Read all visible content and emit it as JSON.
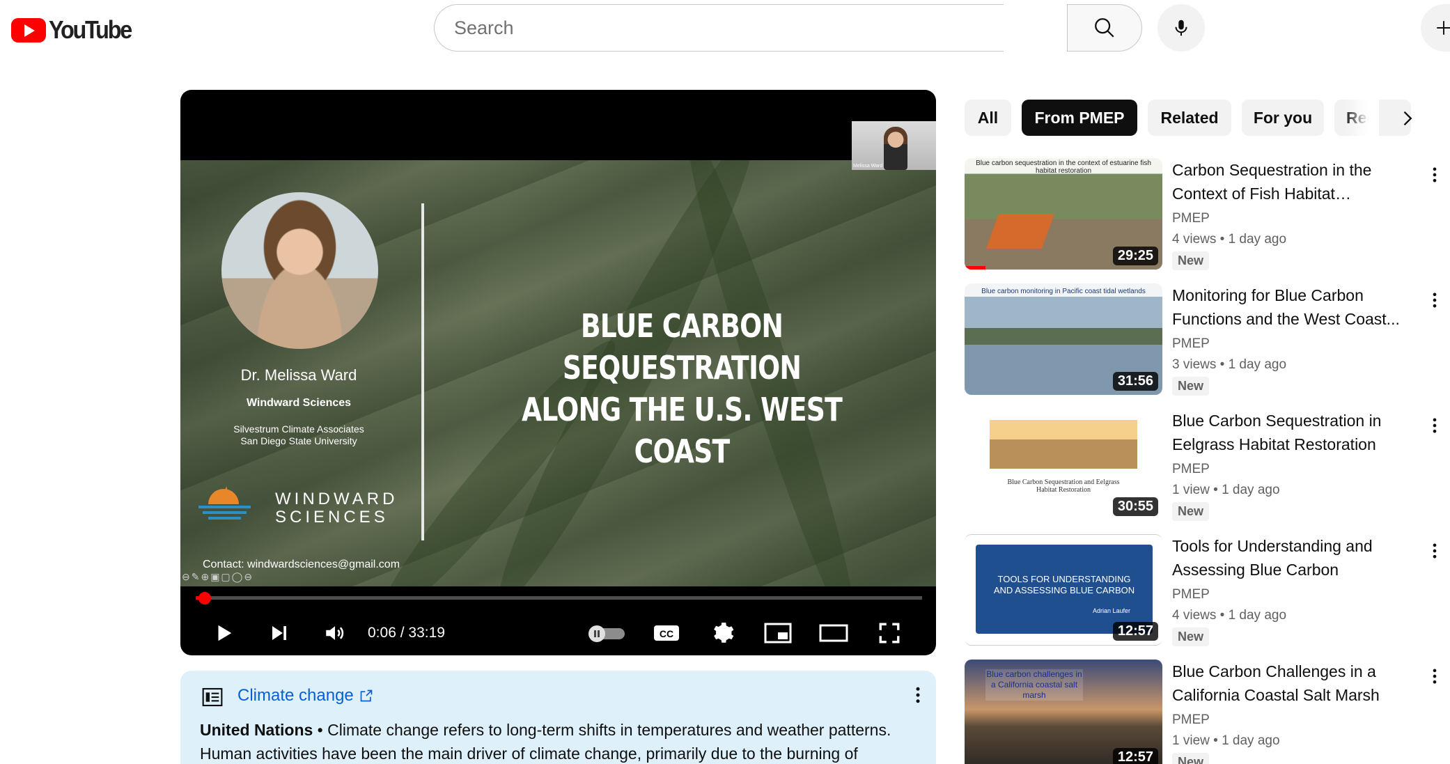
{
  "masthead": {
    "logo_text": "YouTube",
    "search_placeholder": "Search"
  },
  "player": {
    "slide": {
      "title_line1": "BLUE CARBON SEQUESTRATION",
      "title_line2": "ALONG THE U.S. WEST COAST",
      "speaker_name": "Dr. Melissa Ward",
      "speaker_org": "Windward Sciences",
      "affiliation_line1": "Silvestrum Climate Associates",
      "affiliation_line2": "San Diego State University",
      "logo_line1": "WINDWARD",
      "logo_line2": "SCIENCES",
      "contact": "Contact: windwardsciences@gmail.com",
      "pip_label": "Melissa Ward"
    },
    "progress_fraction": 0.003,
    "time_current": "0:06",
    "time_separator": " / ",
    "time_total": "33:19"
  },
  "info_card": {
    "link_text": "Climate change",
    "source": "United Nations",
    "bullet": " • ",
    "description": "Climate change refers to long-term shifts in temperatures and weather patterns. Human activities have been the main driver of climate change, primarily due to the burning of"
  },
  "chips": [
    {
      "label": "All",
      "active": false
    },
    {
      "label": "From PMEP",
      "active": true
    },
    {
      "label": "Related",
      "active": false
    },
    {
      "label": "For you",
      "active": false
    },
    {
      "label": "Rec",
      "active": false
    }
  ],
  "recommendations": [
    {
      "title": "Carbon Sequestration in the Context of Fish Habitat Restoration",
      "channel": "PMEP",
      "views": "4 views",
      "age": "1 day ago",
      "badge": "New",
      "duration": "29:25",
      "thumb_caption": "Blue carbon sequestration in the context of estuarine fish habitat restoration"
    },
    {
      "title": "Monitoring for Blue Carbon Functions and the West Coast...",
      "channel": "PMEP",
      "views": "3 views",
      "age": "1 day ago",
      "badge": "New",
      "duration": "31:56",
      "thumb_caption": "Blue carbon monitoring in Pacific coast tidal wetlands"
    },
    {
      "title": "Blue Carbon Sequestration in Eelgrass Habitat Restoration",
      "channel": "PMEP",
      "views": "1 view",
      "age": "1 day ago",
      "badge": "New",
      "duration": "30:55",
      "thumb_caption": "Blue Carbon Sequestration and Eelgrass Habitat Restoration"
    },
    {
      "title": "Tools for Understanding and Assessing Blue Carbon",
      "channel": "PMEP",
      "views": "4 views",
      "age": "1 day ago",
      "badge": "New",
      "duration": "12:57",
      "thumb_caption": "TOOLS FOR UNDERSTANDING AND ASSESSING BLUE CARBON",
      "thumb_author": "Adrian Laufer"
    },
    {
      "title": "Blue Carbon Challenges in a California Coastal Salt Marsh",
      "channel": "PMEP",
      "views": "1 view",
      "age": "1 day ago",
      "badge": "New",
      "duration": "12:57",
      "thumb_caption": "Blue carbon challenges in a California coastal salt marsh"
    }
  ],
  "colors": {
    "brand_red": "#ff0000",
    "link_blue": "#065fd4",
    "info_bg": "#def1fb"
  }
}
